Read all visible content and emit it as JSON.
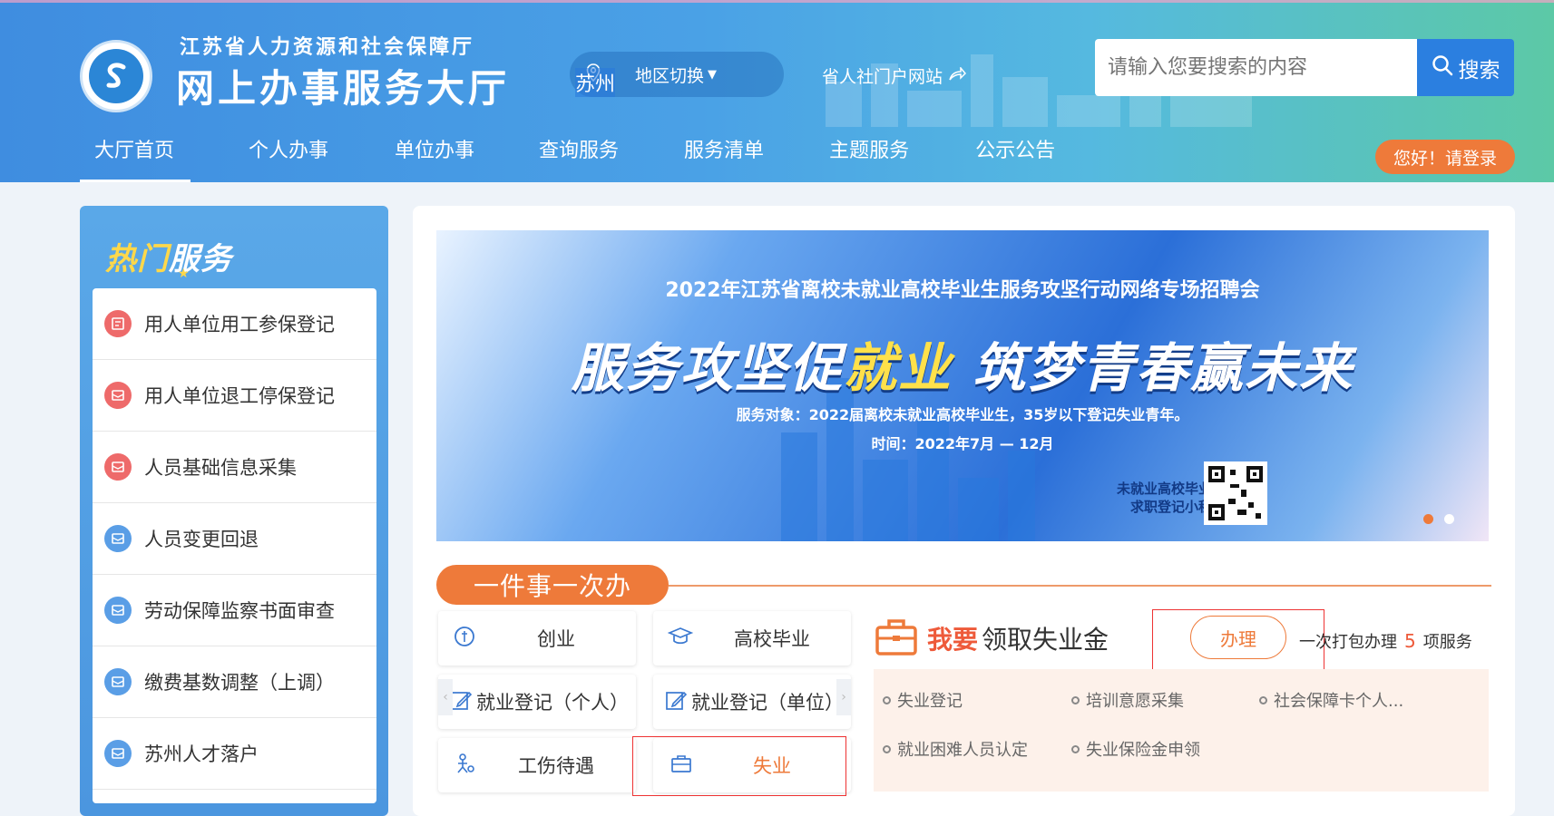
{
  "header": {
    "org_name": "江苏省人力资源和社会保障厅",
    "hall_name": "网上办事服务大厅",
    "city": "苏州",
    "region_switch": "地区切换",
    "portal_link": "省人社门户网站",
    "search_placeholder": "请输入您要搜索的内容",
    "search_button": "搜索",
    "login": "您好！请登录"
  },
  "nav": {
    "items": [
      "大厅首页",
      "个人办事",
      "单位办事",
      "查询服务",
      "服务清单",
      "主题服务",
      "公示公告"
    ],
    "active": "大厅首页"
  },
  "hot_services": {
    "title_a": "热门",
    "title_b": "服务",
    "items": [
      {
        "label": "用人单位用工参保登记",
        "color": "#ee6a6a"
      },
      {
        "label": "用人单位退工停保登记",
        "color": "#ee6a6a"
      },
      {
        "label": "人员基础信息采集",
        "color": "#ee6a6a"
      },
      {
        "label": "人员变更回退",
        "color": "#5a9ee6"
      },
      {
        "label": "劳动保障监察书面审查",
        "color": "#5a9ee6"
      },
      {
        "label": "缴费基数调整（上调）",
        "color": "#5a9ee6"
      },
      {
        "label": "苏州人才落户",
        "color": "#5a9ee6"
      }
    ]
  },
  "banner": {
    "subtitle": "2022年江苏省离校未就业高校毕业生服务攻坚行动网络专场招聘会",
    "headline_a": "服务攻坚促",
    "headline_b": "就业",
    "headline_c": " 筑梦青春赢未来",
    "target": "服务对象：2022届离校未就业高校毕业生，35岁以下登记失业青年。",
    "time": "时间：2022年7月 — 12月",
    "mini_line1": "未就业高校毕业生",
    "mini_line2": "求职登记小程序",
    "slide_count": 2,
    "active_slide": 0
  },
  "once": {
    "tab": "一件事一次办",
    "categories": [
      "创业",
      "高校毕业",
      "就业登记（个人）",
      "就业登记（单位）",
      "工伤待遇",
      "失业"
    ],
    "selected": "失业",
    "want_prefix": "我要",
    "want_action": "领取失业金",
    "handle_button": "办理",
    "pack_prefix": "一次打包办理",
    "pack_count": "5",
    "pack_suffix": "项服务",
    "services": [
      "失业登记",
      "培训意愿采集",
      "社会保障卡个人...",
      "就业困难人员认定",
      "失业保险金申领"
    ]
  },
  "colors": {
    "accent_orange": "#ee7a3a",
    "brand_blue": "#2b7fe0",
    "highlight_red": "#ee5a3a"
  }
}
